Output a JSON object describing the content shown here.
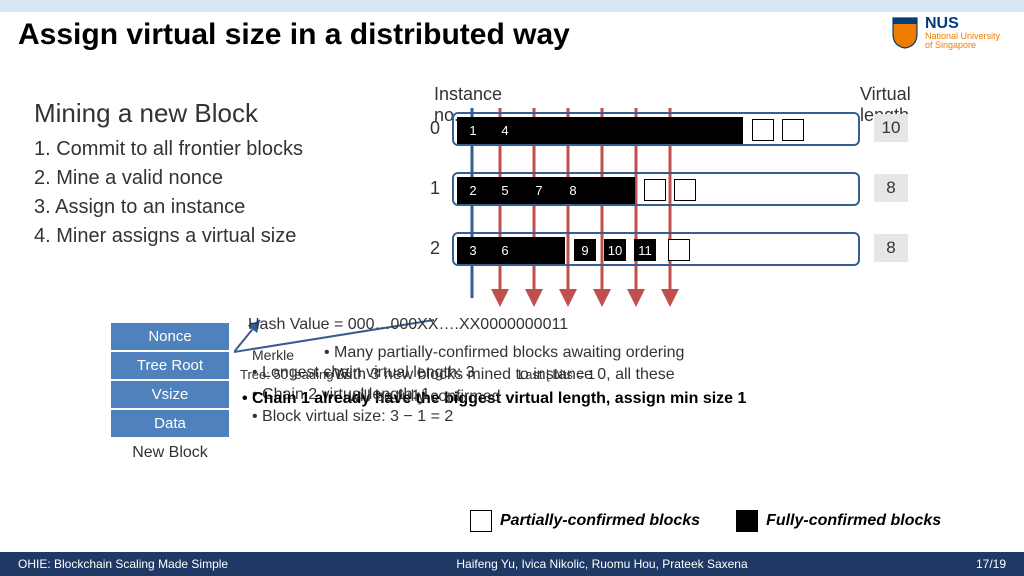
{
  "header": {
    "title": "Assign virtual size in a distributed way",
    "logo": {
      "abbrev": "NUS",
      "line1": "National University",
      "line2": "of Singapore"
    }
  },
  "mining": {
    "title": "Mining a new Block",
    "steps": [
      "1. Commit to all frontier blocks",
      "2. Mine a valid nonce",
      "3. Assign to an instance",
      "4. Miner assigns a virtual size"
    ]
  },
  "new_block": {
    "rows": [
      "Nonce",
      "Tree Root",
      "Vsize",
      "Data"
    ],
    "label": "New Block"
  },
  "instances": {
    "header_left": "Instance no.",
    "header_right": "Virtual length",
    "rows": [
      {
        "label": "0",
        "vlen": "10",
        "blocks": [
          "1",
          "4"
        ],
        "partials": 2,
        "big_width": 286
      },
      {
        "label": "1",
        "vlen": "8",
        "blocks": [
          "2",
          "5",
          "7",
          "8"
        ],
        "partials": 2,
        "big_width": 178
      },
      {
        "label": "2",
        "vlen": "8",
        "blocks": [
          "3",
          "6",
          "",
          "9",
          "10",
          "11"
        ],
        "partials": 1,
        "big_width": 108,
        "gap_after": 6
      }
    ]
  },
  "hash": {
    "line1": "Hash Value = 000…000XX….XX0000000011",
    "merkle": "Merkle",
    "tree_prefix": "Tree: 50 leading 0s",
    "last_bits": "Last ɭ bits = 1",
    "bullets_overlay": [
      "Many partially-confirmed blocks awaiting ordering",
      "Longest chain virtual length: 3",
      "Chain 2 virtual length: 1",
      "With 3 new blocks mined to instance 0, all these",
      "Chain 1 already have the biggest virtual length, assign min size 1",
      "will be fully confirmed",
      "Block virtual size: 3 − 1 = 2"
    ]
  },
  "legend": {
    "partial": "Partially-confirmed blocks",
    "full": "Fully-confirmed blocks"
  },
  "footer": {
    "left": "OHIE: Blockchain Scaling Made Simple",
    "mid": "Haifeng Yu, Ivica Nikolic, Ruomu Hou, Prateek Saxena",
    "right": "17/19"
  }
}
